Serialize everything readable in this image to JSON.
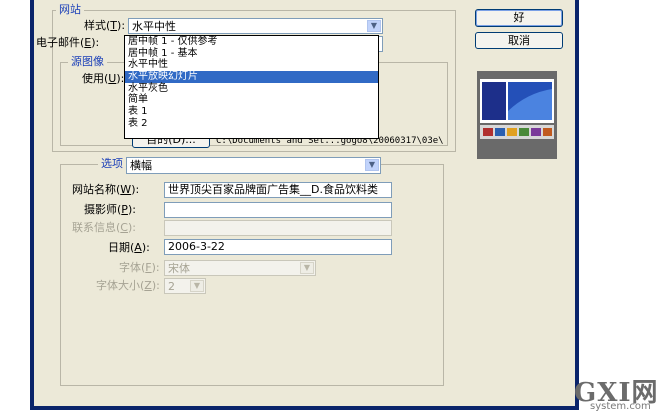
{
  "site_group": {
    "legend": "网站"
  },
  "style_field": {
    "label": "样式",
    "hotkey": "T",
    "value": "水平中性"
  },
  "email_field": {
    "label": "电子邮件",
    "hotkey": "E"
  },
  "style_dropdown": {
    "items": [
      "居中帧 1 - 仅供参考",
      "居中帧 1 - 基本",
      "水平中性",
      "水平放映幻灯片",
      "水平灰色",
      "简单",
      "表 1",
      "表 2"
    ],
    "selected": "水平放映幻灯片"
  },
  "source_group": {
    "legend": "源图像",
    "use_label": "使用",
    "use_hotkey": "U",
    "browse_button": "目的(D)...",
    "path": "C:\\Documents and Set...gogo8\\20060317\\03e\\"
  },
  "options": {
    "label": "选项",
    "value": "横幅",
    "site_name_label": "网站名称",
    "site_name_hotkey": "W",
    "site_name_value": "世界顶尖百家品牌面广告集__D.食品饮料类",
    "photographer_label": "摄影师",
    "photographer_hotkey": "P",
    "photographer_value": "",
    "contact_label": "联系信息",
    "contact_hotkey": "C",
    "contact_value": "",
    "date_label": "日期",
    "date_hotkey": "A",
    "date_value": "2006-3-22",
    "font_label": "字体",
    "font_hotkey": "F",
    "font_value": "宋体",
    "font_size_label": "字体大小",
    "font_size_hotkey": "Z",
    "font_size_value": "2"
  },
  "buttons": {
    "ok": "好",
    "cancel": "取消"
  },
  "watermark": {
    "main": "GXI网",
    "sub": "system.com"
  },
  "colors": {
    "accent": "#316ac5",
    "frame": "#0a246a",
    "dialog_bg": "#ece9d8",
    "legend_text": "#1a3fb8"
  }
}
